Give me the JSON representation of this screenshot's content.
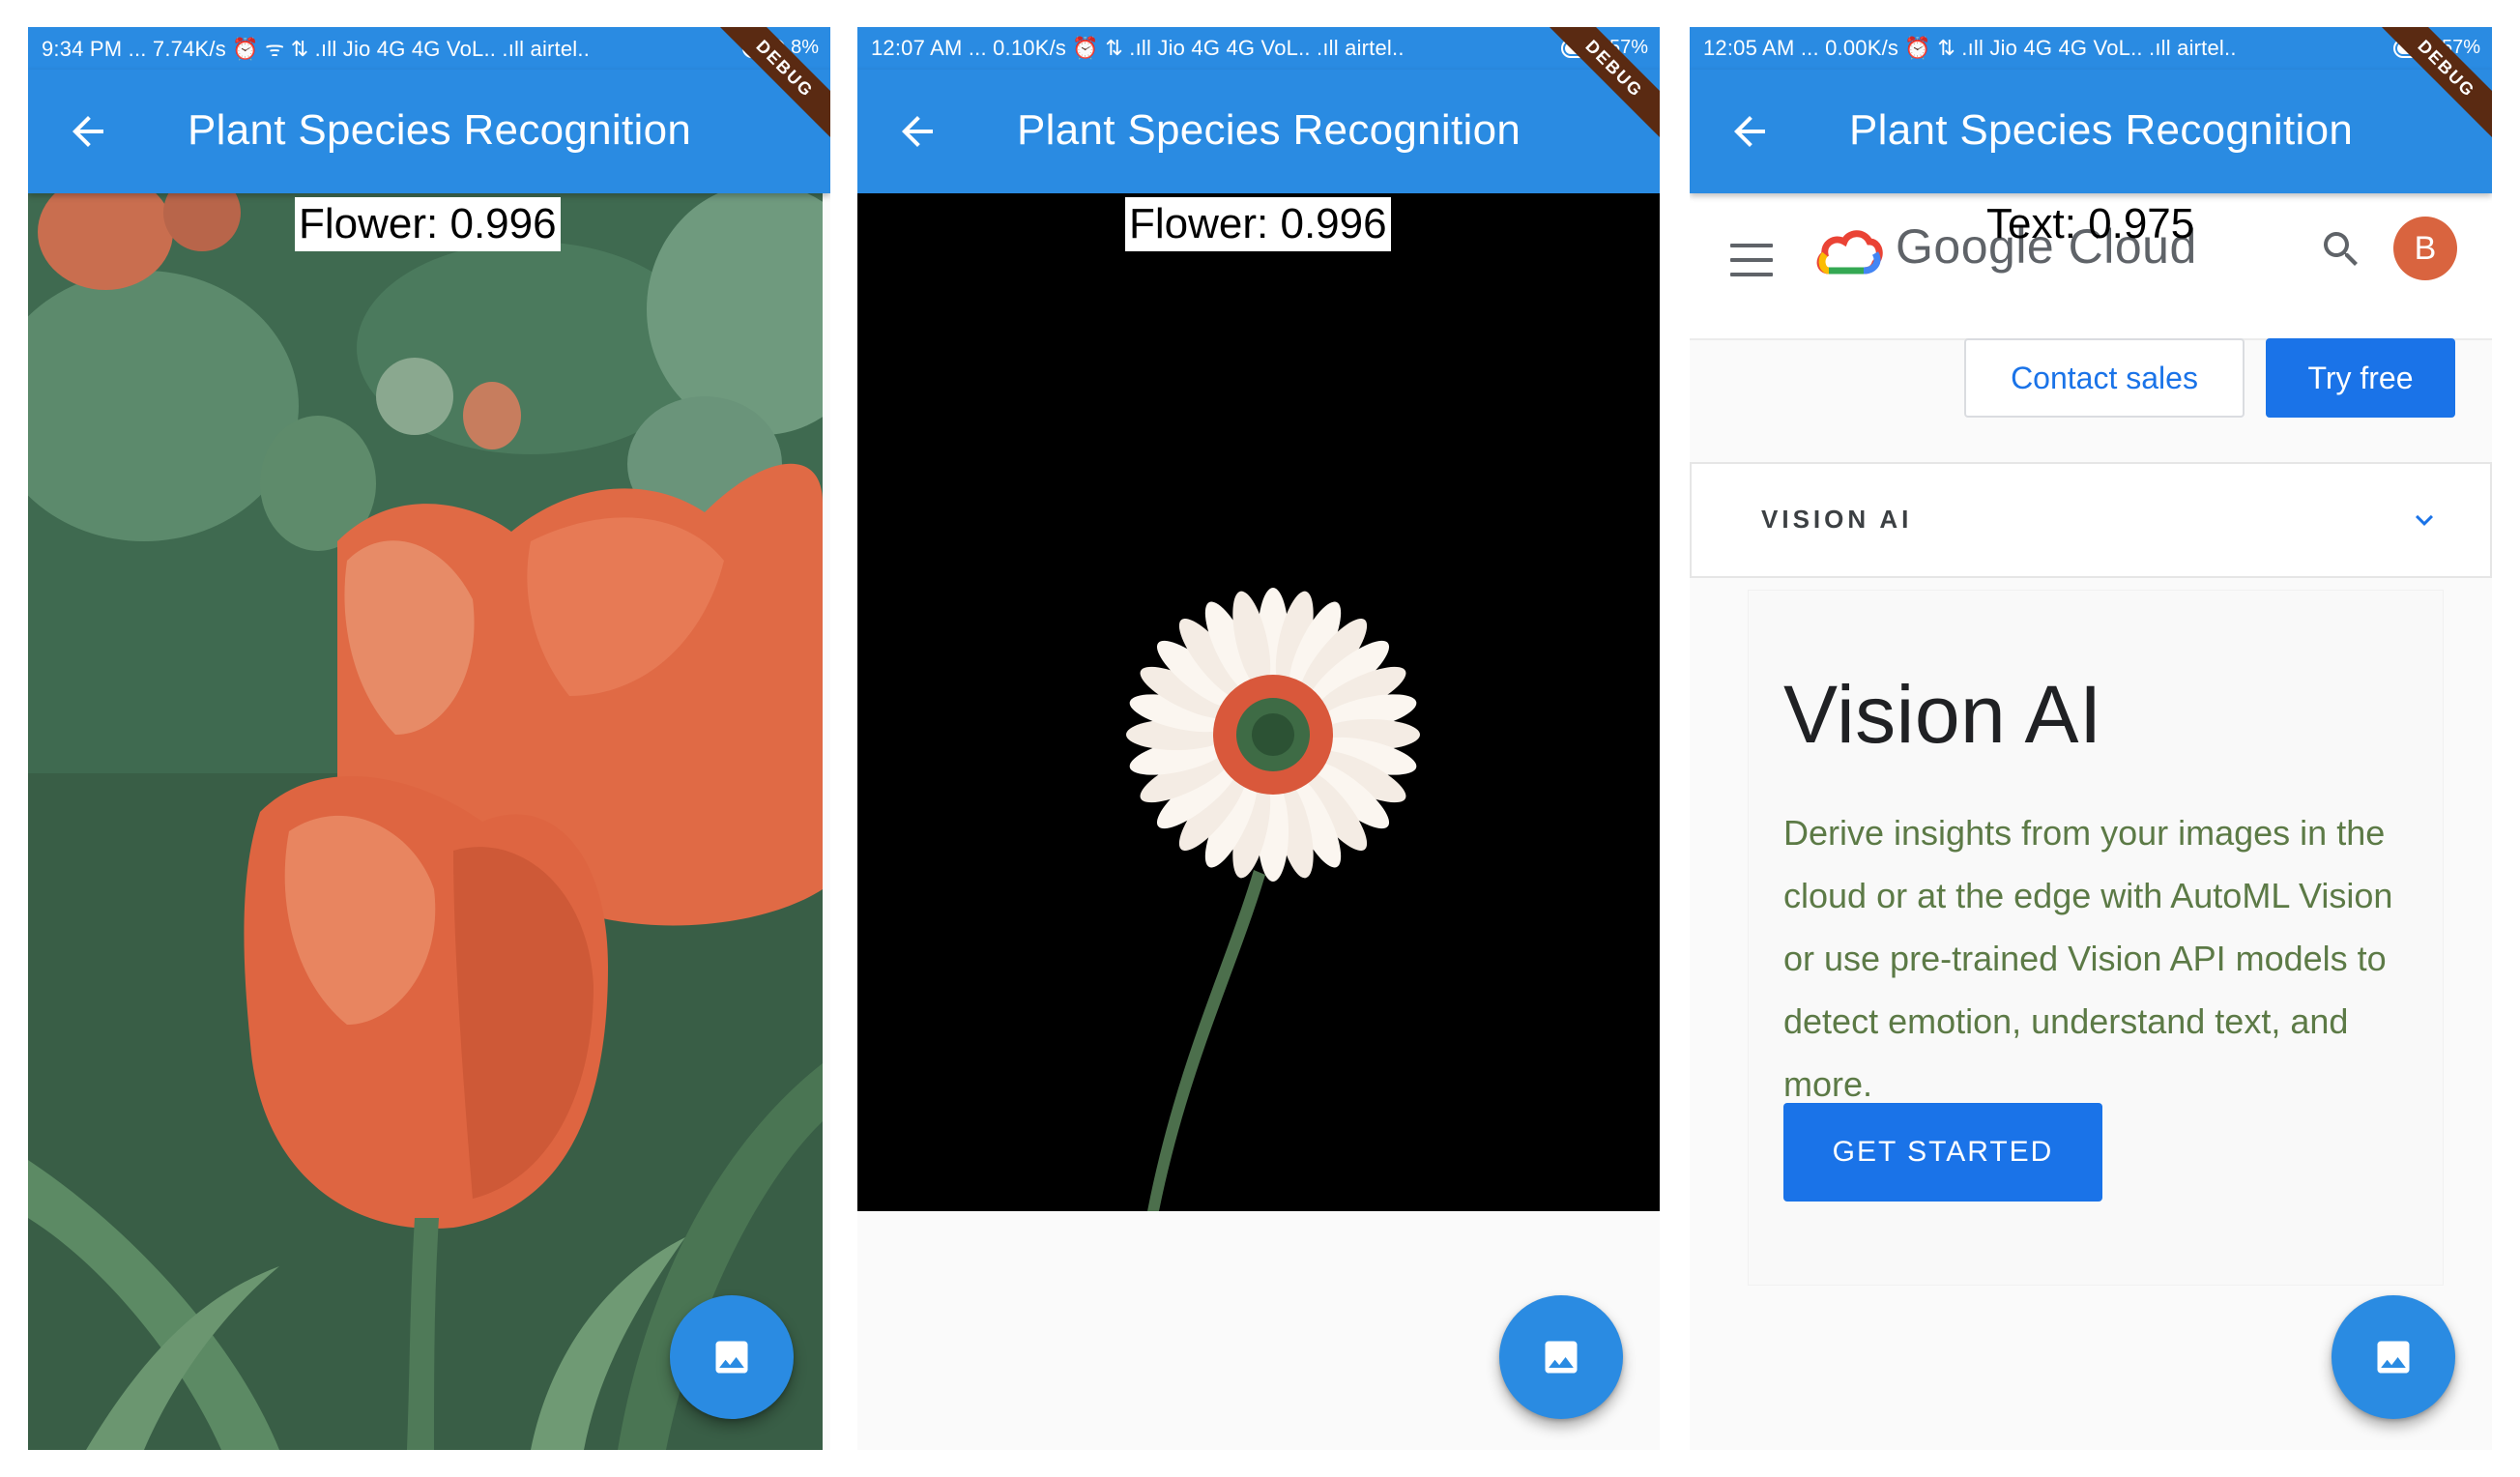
{
  "screens": [
    {
      "status_bar": {
        "text": "9:34 PM  ...  7.74K/s  ⏰  ᯤ  ⇅  .ıll  Jio 4G  4G  VoL..  .ıll  airtel..",
        "battery": "8%",
        "battery_level": 0.08
      },
      "app_bar": {
        "title": "Plant Species Recognition"
      },
      "debug_banner": "DEBUG",
      "result_label": "Flower: 0.996"
    },
    {
      "status_bar": {
        "text": "12:07 AM  ...  0.10K/s  ⏰  ⇅  .ıll  Jio 4G  4G  VoL..  .ıll  airtel..",
        "battery": "57%",
        "battery_level": 0.57
      },
      "app_bar": {
        "title": "Plant Species Recognition"
      },
      "debug_banner": "DEBUG",
      "result_label": "Flower: 0.996"
    },
    {
      "status_bar": {
        "text": "12:05 AM  ...  0.00K/s  ⏰  ⇅  .ıll  Jio 4G  4G  VoL..  .ıll  airtel..",
        "battery": "57%",
        "battery_level": 0.57
      },
      "app_bar": {
        "title": "Plant Species Recognition"
      },
      "debug_banner": "DEBUG",
      "result_label": "Text: 0.975",
      "web": {
        "brand": "Google Cloud",
        "avatar_initial": "B",
        "contact_label": "Contact sales",
        "try_label": "Try free",
        "accordion_label": "VISION AI",
        "hero_title": "Vision AI",
        "hero_desc": "Derive insights from your images in the cloud or at the edge with AutoML Vision or use pre-trained Vision API models to detect emotion, understand text, and more.",
        "cta_label": "GET STARTED"
      }
    }
  ],
  "colors": {
    "app_bar": "#2a8be2",
    "fab": "#2a8be2",
    "google_blue": "#1a73e8",
    "debug_banner": "#5a2a12",
    "avatar": "#d9643f"
  },
  "icons": {
    "back": "arrow-left-icon",
    "fab": "image-icon",
    "menu": "hamburger-icon",
    "search": "search-icon",
    "accordion": "chevron-down-icon",
    "logo": "google-cloud-logo-icon"
  }
}
